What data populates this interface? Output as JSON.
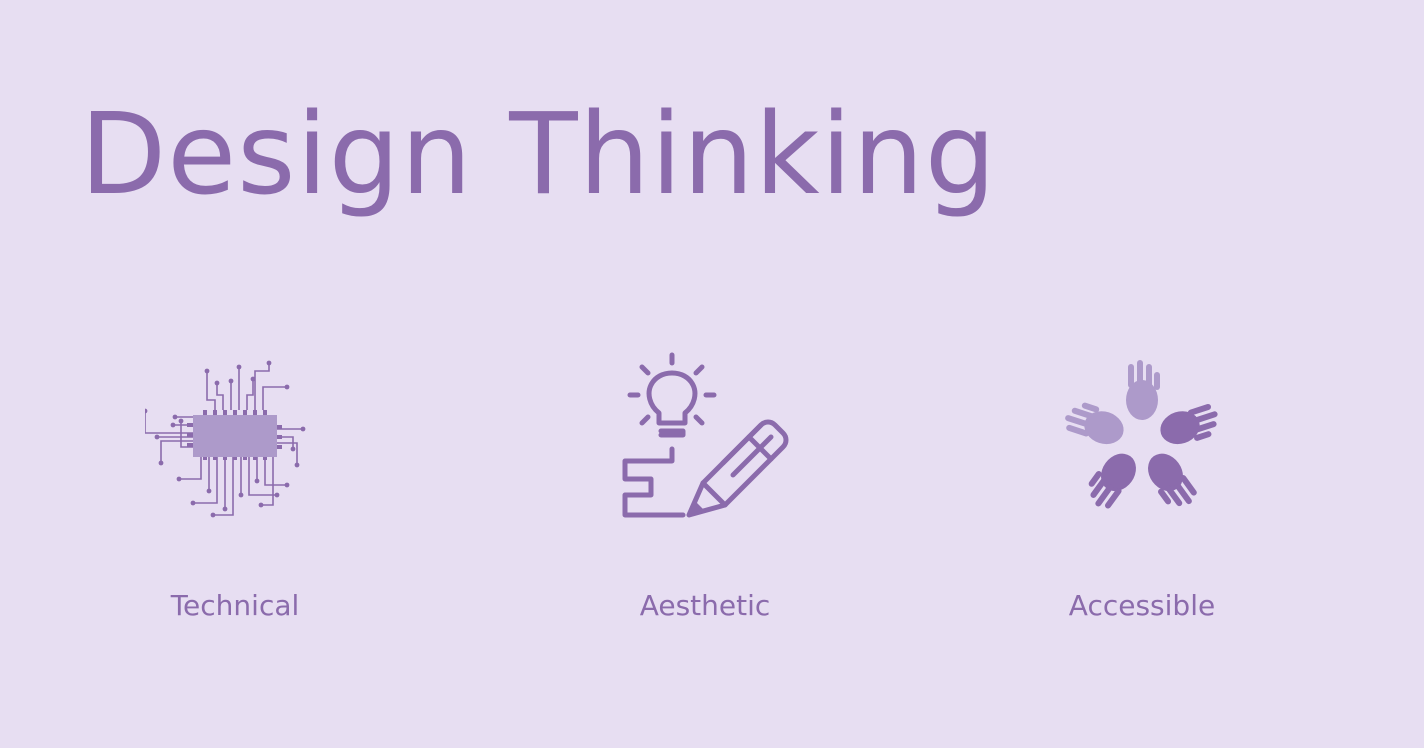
{
  "title": "Design Thinking",
  "colors": {
    "background": "#e7def2",
    "accent": "#8b6bac",
    "accent_light": "#ad9aca"
  },
  "features": [
    {
      "label": "Technical",
      "icon": "circuit-chip-icon"
    },
    {
      "label": "Aesthetic",
      "icon": "lightbulb-pencil-icon"
    },
    {
      "label": "Accessible",
      "icon": "hands-circle-icon"
    }
  ]
}
